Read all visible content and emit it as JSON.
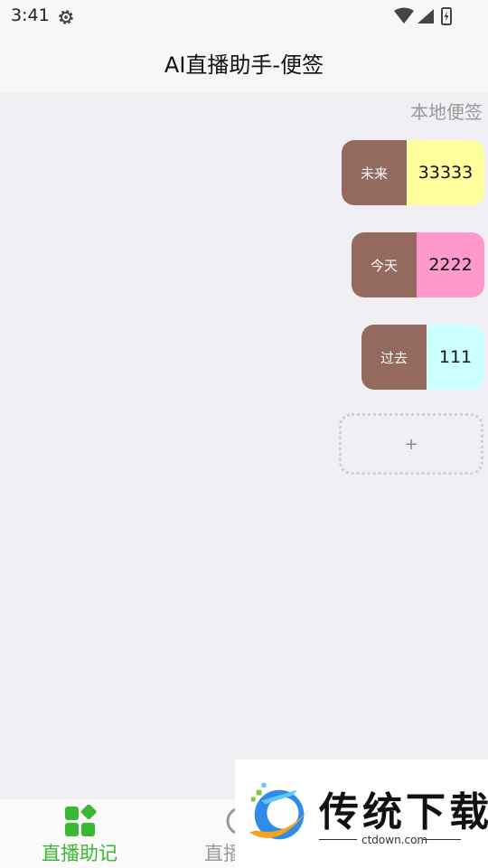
{
  "status_bar": {
    "time": "3:41"
  },
  "header": {
    "title": "AI直播助手-便签"
  },
  "section": {
    "label": "本地便签"
  },
  "notes": [
    {
      "tag": "未来",
      "value": "33333",
      "color": "#ffff9e"
    },
    {
      "tag": "今天",
      "value": "2222",
      "color": "#ff99cc"
    },
    {
      "tag": "过去",
      "value": "111",
      "color": "#ccffff"
    }
  ],
  "add_button": {
    "label": "+"
  },
  "bottom_nav": {
    "items": [
      {
        "label": "直播助记",
        "active": true,
        "color": "#3bb832"
      },
      {
        "label": "直播",
        "active": false,
        "color": "#999999"
      }
    ]
  },
  "watermark": {
    "title": "传统下载",
    "url": "ctdown.com"
  }
}
